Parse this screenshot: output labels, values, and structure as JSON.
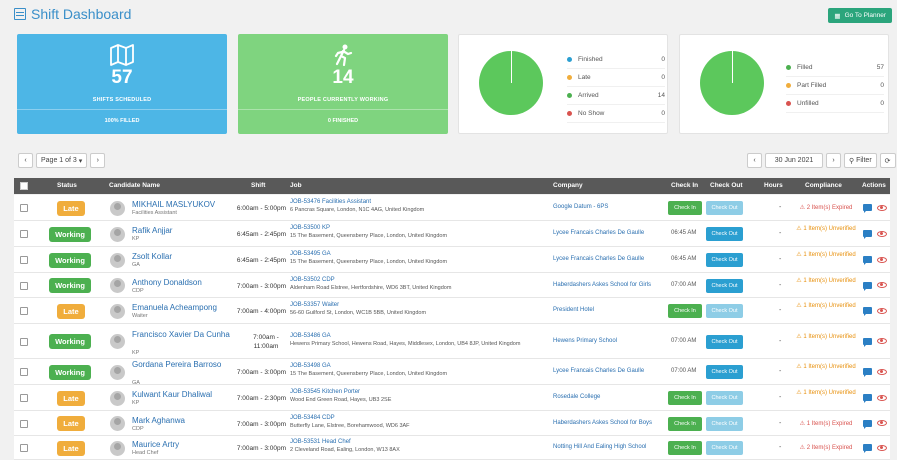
{
  "header": {
    "title": "Shift Dashboard",
    "planner_button": "Go To Planner"
  },
  "cards": {
    "scheduled": {
      "number": "57",
      "label": "SHIFTS SCHEDULED",
      "footer": "100% FILLED",
      "color": "#4db6e6"
    },
    "working": {
      "number": "14",
      "label": "PEOPLE CURRENTLY WORKING",
      "footer": "0 FINISHED",
      "color": "#7fd47f"
    },
    "attendance": {
      "items": [
        {
          "label": "Finished",
          "value": "0",
          "color": "#2b9fd1"
        },
        {
          "label": "Late",
          "value": "0",
          "color": "#f0ad3c"
        },
        {
          "label": "Arrived",
          "value": "14",
          "color": "#4cb050"
        },
        {
          "label": "No Show",
          "value": "0",
          "color": "#d9534f"
        }
      ]
    },
    "fill": {
      "items": [
        {
          "label": "Filled",
          "value": "57",
          "color": "#4cb050"
        },
        {
          "label": "Part Filled",
          "value": "0",
          "color": "#f0ad3c"
        },
        {
          "label": "Unfilled",
          "value": "0",
          "color": "#d9534f"
        }
      ]
    }
  },
  "pagination": {
    "page_label": "Page 1 of 3",
    "date": "30 Jun 2021",
    "filter": "Filter"
  },
  "columns": {
    "status": "Status",
    "candidate": "Candidate Name",
    "shift": "Shift",
    "job": "Job",
    "company": "Company",
    "check_in": "Check In",
    "check_out": "Check Out",
    "hours": "Hours",
    "compliance": "Compliance",
    "actions": "Actions"
  },
  "rows": [
    {
      "status": "Late",
      "name": "MIKHAIL MASLYUKOV",
      "role": "Facilities Assistant",
      "time": "6:00am - 5:00pm",
      "job": "JOB-53476 Facilities Assistant",
      "address": "6 Pancras Square, London, N1C 4AG, United Kingdom",
      "company": "Google Datum - 6PS",
      "check_in": "Check In",
      "check_out": "Check Out",
      "co_style": "light",
      "device": "",
      "hours": "-",
      "compliance": "2 Item(s) Expired",
      "comp_color": "red"
    },
    {
      "status": "Working",
      "name": "Rafik Anjjar",
      "role": "KP",
      "time": "6:45am - 2:45pm",
      "job": "JOB-53500 KP",
      "address": "15 The Basement, Queensberry Place, London, United Kingdom",
      "company": "Lycee Francais Charles De Gaulle",
      "check_in": "06:45 AM",
      "check_out": "Check Out",
      "co_style": "dark",
      "device": "",
      "hours": "-",
      "compliance": "1 Item(s) Unverified",
      "comp_color": "orange"
    },
    {
      "status": "Working",
      "name": "Zsolt Kollar",
      "role": "GA",
      "time": "6:45am - 2:45pm",
      "job": "JOB-53495 GA",
      "address": "15 The Basement, Queensberry Place, London, United Kingdom",
      "company": "Lycee Francais Charles De Gaulle",
      "check_in": "06:45 AM",
      "check_out": "Check Out",
      "co_style": "dark",
      "device": "",
      "hours": "-",
      "compliance": "1 Item(s) Unverified",
      "comp_color": "orange"
    },
    {
      "status": "Working",
      "name": "Anthony Donaldson",
      "role": "CDP",
      "time": "7:00am - 3:00pm",
      "job": "JOB-53502 CDP",
      "address": "Aldenham Road Elstree, Hertfordshire, WD6 3BT, United Kingdom",
      "company": "Haberdashers Askes School for Girls",
      "check_in": "07:00 AM",
      "check_out": "Check Out",
      "co_style": "dark",
      "device": "",
      "hours": "-",
      "compliance": "1 Item(s) Unverified",
      "comp_color": "orange"
    },
    {
      "status": "Late",
      "name": "Emanuela Acheampong",
      "role": "Waiter",
      "time": "7:00am - 4:00pm",
      "job": "JOB-53357 Waiter",
      "address": "56-60 Guilford St, London, WC1B 5BB, United Kingdom",
      "company": "President Hotel",
      "check_in": "Check In",
      "check_out": "Check Out",
      "co_style": "light",
      "device": "",
      "hours": "-",
      "compliance": "1 Item(s) Unverified",
      "comp_color": "orange"
    },
    {
      "status": "Working",
      "name": "Francisco Xavier Da Cunha",
      "role": "KP",
      "time": "7:00am - 11:00am",
      "job": "JOB-53486 GA",
      "address": "Hewens Primary School, Hewens Road, Hayes, Middlesex, London, UB4 8JP, United Kingdom",
      "company": "Hewens Primary School",
      "check_in": "07:00 AM",
      "check_out": "Check Out",
      "co_style": "dark",
      "device": "",
      "hours": "-",
      "compliance": "1 Item(s) Unverified",
      "comp_color": "orange"
    },
    {
      "status": "Working",
      "name": "Gordana Pereira Barroso",
      "role": "GA",
      "time": "7:00am - 3:00pm",
      "job": "JOB-53498 GA",
      "address": "15 The Basement, Queensberry Place, London, United Kingdom",
      "company": "Lycee Francais Charles De Gaulle",
      "check_in": "07:00 AM",
      "check_out": "Check Out",
      "co_style": "dark",
      "device": "",
      "hours": "-",
      "compliance": "1 Item(s) Unverified",
      "comp_color": "orange"
    },
    {
      "status": "Late",
      "name": "Kulwant Kaur Dhaliwal",
      "role": "KP",
      "time": "7:00am - 2:30pm",
      "job": "JOB-53545 Kitchen Porter",
      "address": "Wood End Green Road, Hayes, UB3 2SE",
      "company": "Rosedale College",
      "check_in": "Check In",
      "check_out": "Check Out",
      "co_style": "light",
      "device": "",
      "hours": "-",
      "compliance": "1 Item(s) Unverified",
      "comp_color": "orange"
    },
    {
      "status": "Late",
      "name": "Mark Aghanwa",
      "role": "CDP",
      "time": "7:00am - 3:00pm",
      "job": "JOB-53484 CDP",
      "address": "Butterfly Lane, Elstree, Borehamwood, WD6 3AF",
      "company": "Haberdashers Askes School for Boys",
      "check_in": "Check In",
      "check_out": "Check Out",
      "co_style": "light",
      "device": "",
      "hours": "-",
      "compliance": "1 Item(s) Expired",
      "comp_color": "red"
    },
    {
      "status": "Late",
      "name": "Maurice Artry",
      "role": "Head Chef",
      "time": "7:00am - 3:00pm",
      "job": "JOB-53531 Head Chef",
      "address": "2 Cleveland Road, Ealing, London, W13 8AX",
      "company": "Notting Hill And Ealing High School",
      "check_in": "Check In",
      "check_out": "Check Out",
      "co_style": "light",
      "device": "",
      "hours": "-",
      "compliance": "2 Item(s) Expired",
      "comp_color": "red"
    }
  ]
}
